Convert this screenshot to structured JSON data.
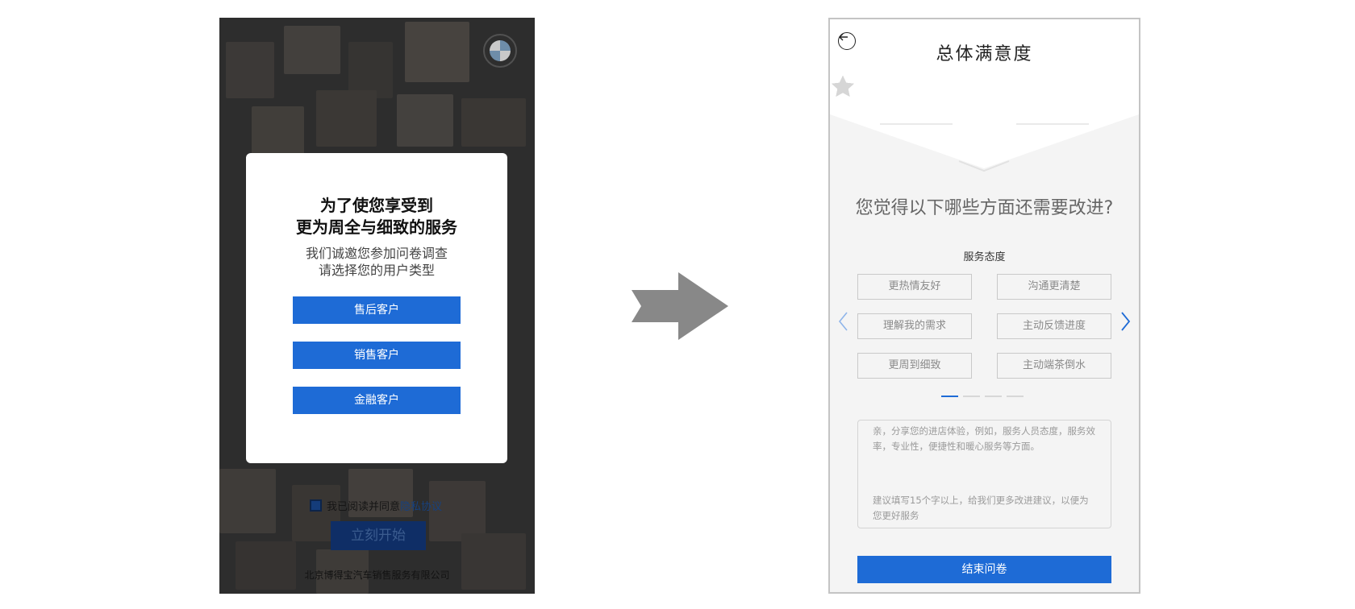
{
  "survey_intro": {
    "title": "为了使您享受到\n更为周全与细致的服务",
    "subtitle": "我们诚邀您参加问卷调查\n请选择您的用户类型",
    "user_types": [
      "售后客户",
      "销售客户",
      "金融客户"
    ],
    "agreement_text": "我已阅读并同意",
    "agreement_link": "隐私协议",
    "start_button": "立刻开始",
    "company": "北京博得宝汽车销售服务有限公司"
  },
  "survey_page": {
    "title": "总体满意度",
    "rating": 0,
    "max_rating": 5,
    "question": "您觉得以下哪些方面还需要改进?",
    "category": "服务态度",
    "options": [
      "更热情友好",
      "沟通更清楚",
      "理解我的需求",
      "主动反馈进度",
      "更周到细致",
      "主动端茶倒水"
    ],
    "page_count": 4,
    "active_page": 1,
    "feedback_hint_1": "亲，分享您的进店体验，例如，服务人员态度，服务效率，专业性，便捷性和暖心服务等方面。",
    "feedback_hint_2": "建议填写15个字以上，给我们更多改进建议，以便为您更好服务",
    "submit_button": "结束问卷"
  },
  "colors": {
    "primary": "#1e6bd6",
    "star_empty": "#d6d6d6",
    "overlay": "#3a3a3a"
  },
  "icons": [
    "logo-icon",
    "checkbox-icon",
    "transition-arrow-icon",
    "back-arrow-icon",
    "star-icon",
    "chevron-left-icon",
    "chevron-right-icon"
  ]
}
